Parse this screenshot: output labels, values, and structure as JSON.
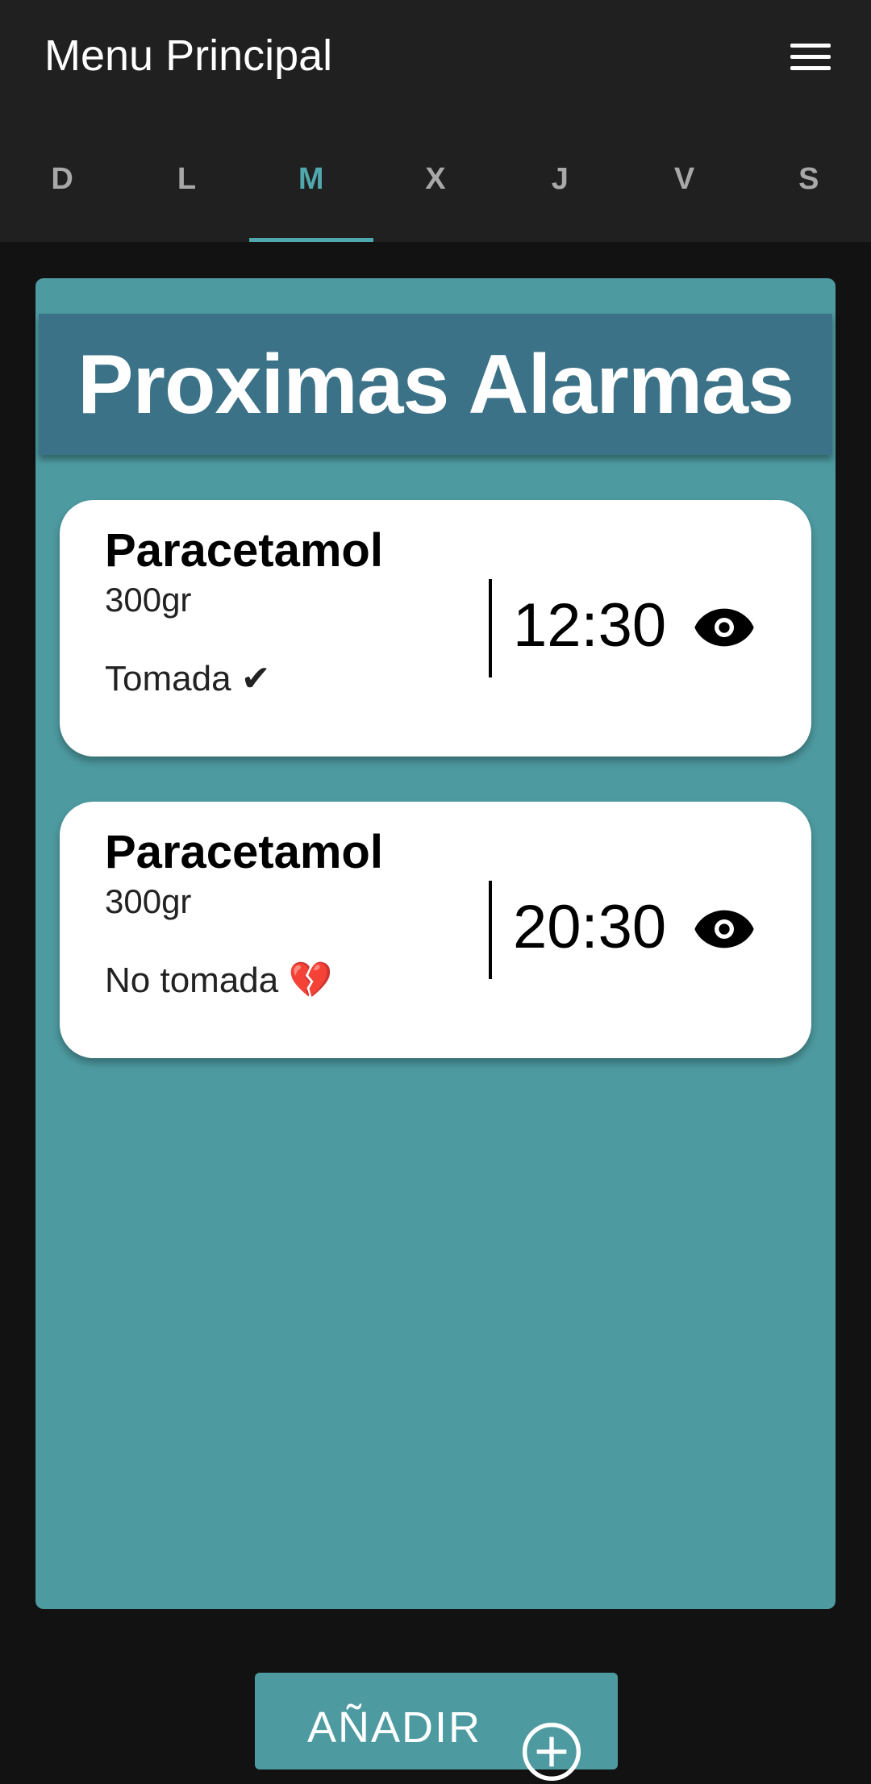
{
  "appbar": {
    "title": "Menu Principal",
    "menu_icon": "hamburger-menu-icon"
  },
  "tabs": [
    {
      "label": "D",
      "active": false
    },
    {
      "label": "L",
      "active": false
    },
    {
      "label": "M",
      "active": true
    },
    {
      "label": "X",
      "active": false
    },
    {
      "label": "J",
      "active": false
    },
    {
      "label": "V",
      "active": false
    },
    {
      "label": "S",
      "active": false
    }
  ],
  "panel": {
    "title": "Proximas Alarmas"
  },
  "alarms": [
    {
      "name": "Paracetamol",
      "dose": "300gr",
      "status": "Tomada ✔",
      "time": "12:30",
      "icon": "eye-icon"
    },
    {
      "name": "Paracetamol",
      "dose": "300gr",
      "status": "No tomada 💔",
      "time": "20:30",
      "icon": "eye-icon"
    }
  ],
  "add_button": {
    "label": "AÑADIR",
    "icon": "add-circle-icon"
  },
  "colors": {
    "accent": "#4fa8ad",
    "panel": "#4d9ba1",
    "header": "#3b7287",
    "appbar": "#202020",
    "background": "#121212"
  }
}
